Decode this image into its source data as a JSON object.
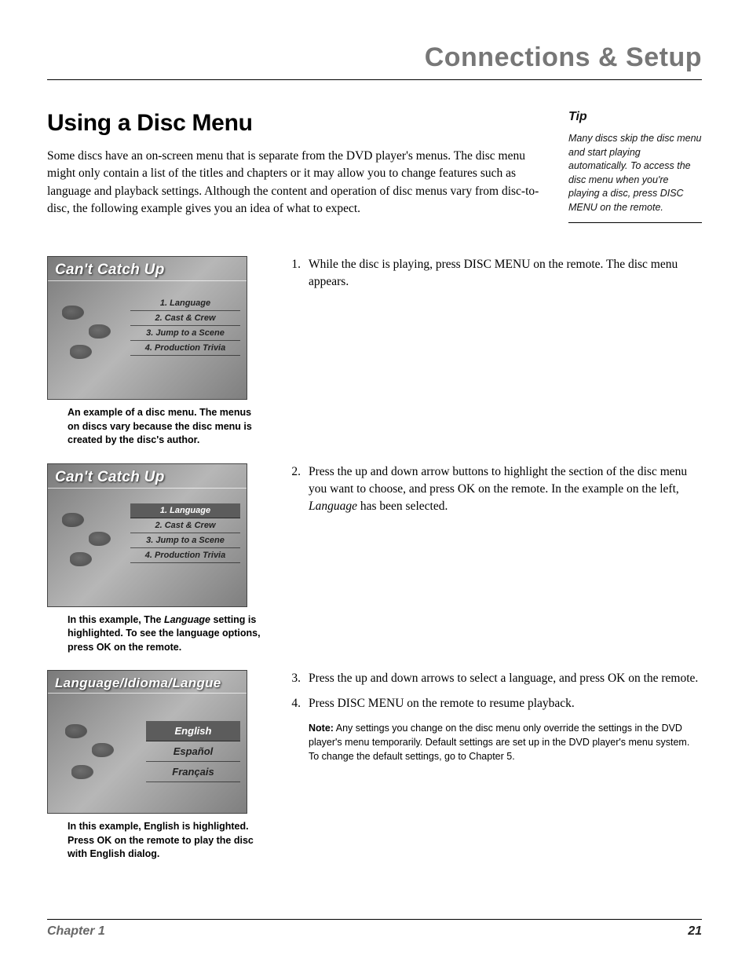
{
  "header": {
    "section": "Connections & Setup"
  },
  "page": {
    "title": "Using a Disc Menu",
    "intro": "Some discs have an on-screen menu that is separate from the DVD player's menus. The disc menu might only contain a list of the titles and chapters or it may allow you to change features such as language and playback settings. Although the content and operation of disc menus vary from disc-to-disc, the following example gives you an idea of what to expect."
  },
  "tip": {
    "heading": "Tip",
    "body": "Many discs skip the disc menu and start playing automatically. To access the disc menu when you're playing a disc, press DISC MENU on the remote."
  },
  "thumbs": {
    "t1": {
      "title": "Can't Catch Up",
      "items": [
        "1. Language",
        "2. Cast & Crew",
        "3. Jump to a Scene",
        "4. Production Trivia"
      ]
    },
    "t2": {
      "title": "Can't Catch Up",
      "items": [
        "1. Language",
        "2. Cast & Crew",
        "3. Jump to a Scene",
        "4. Production Trivia"
      ]
    },
    "t3": {
      "title": "Language/Idioma/Langue",
      "items": [
        "English",
        "Español",
        "Français"
      ]
    }
  },
  "captions": {
    "c1": "An example of a disc menu. The menus on discs vary because the disc menu is created by the disc's author.",
    "c2_a": "In this example, The ",
    "c2_b": "Language",
    "c2_c": " setting is highlighted. To see the language options, press OK on the remote.",
    "c3": "In this example, English is highlighted. Press OK on the remote to play the disc with English dialog."
  },
  "steps": {
    "s1_n": "1.",
    "s1_t": "While the disc is playing, press DISC MENU on the remote. The disc menu appears.",
    "s2_n": "2.",
    "s2_a": "Press the up and down arrow buttons to highlight the section of the disc menu you want to choose, and press OK on the remote. In the example on the left, ",
    "s2_b": "Language",
    "s2_c": " has been selected.",
    "s3_n": "3.",
    "s3_t": "Press the up and down arrows to select a language, and press OK on the remote.",
    "s4_n": "4.",
    "s4_t": "Press DISC MENU on the remote to resume playback."
  },
  "note": {
    "label": "Note:",
    "body": " Any settings you change on the disc menu only override the settings in the DVD player's menu temporarily. Default settings are set up in the DVD player's menu system. To change the default settings, go to Chapter 5."
  },
  "footer": {
    "chapter": "Chapter 1",
    "page_number": "21"
  }
}
